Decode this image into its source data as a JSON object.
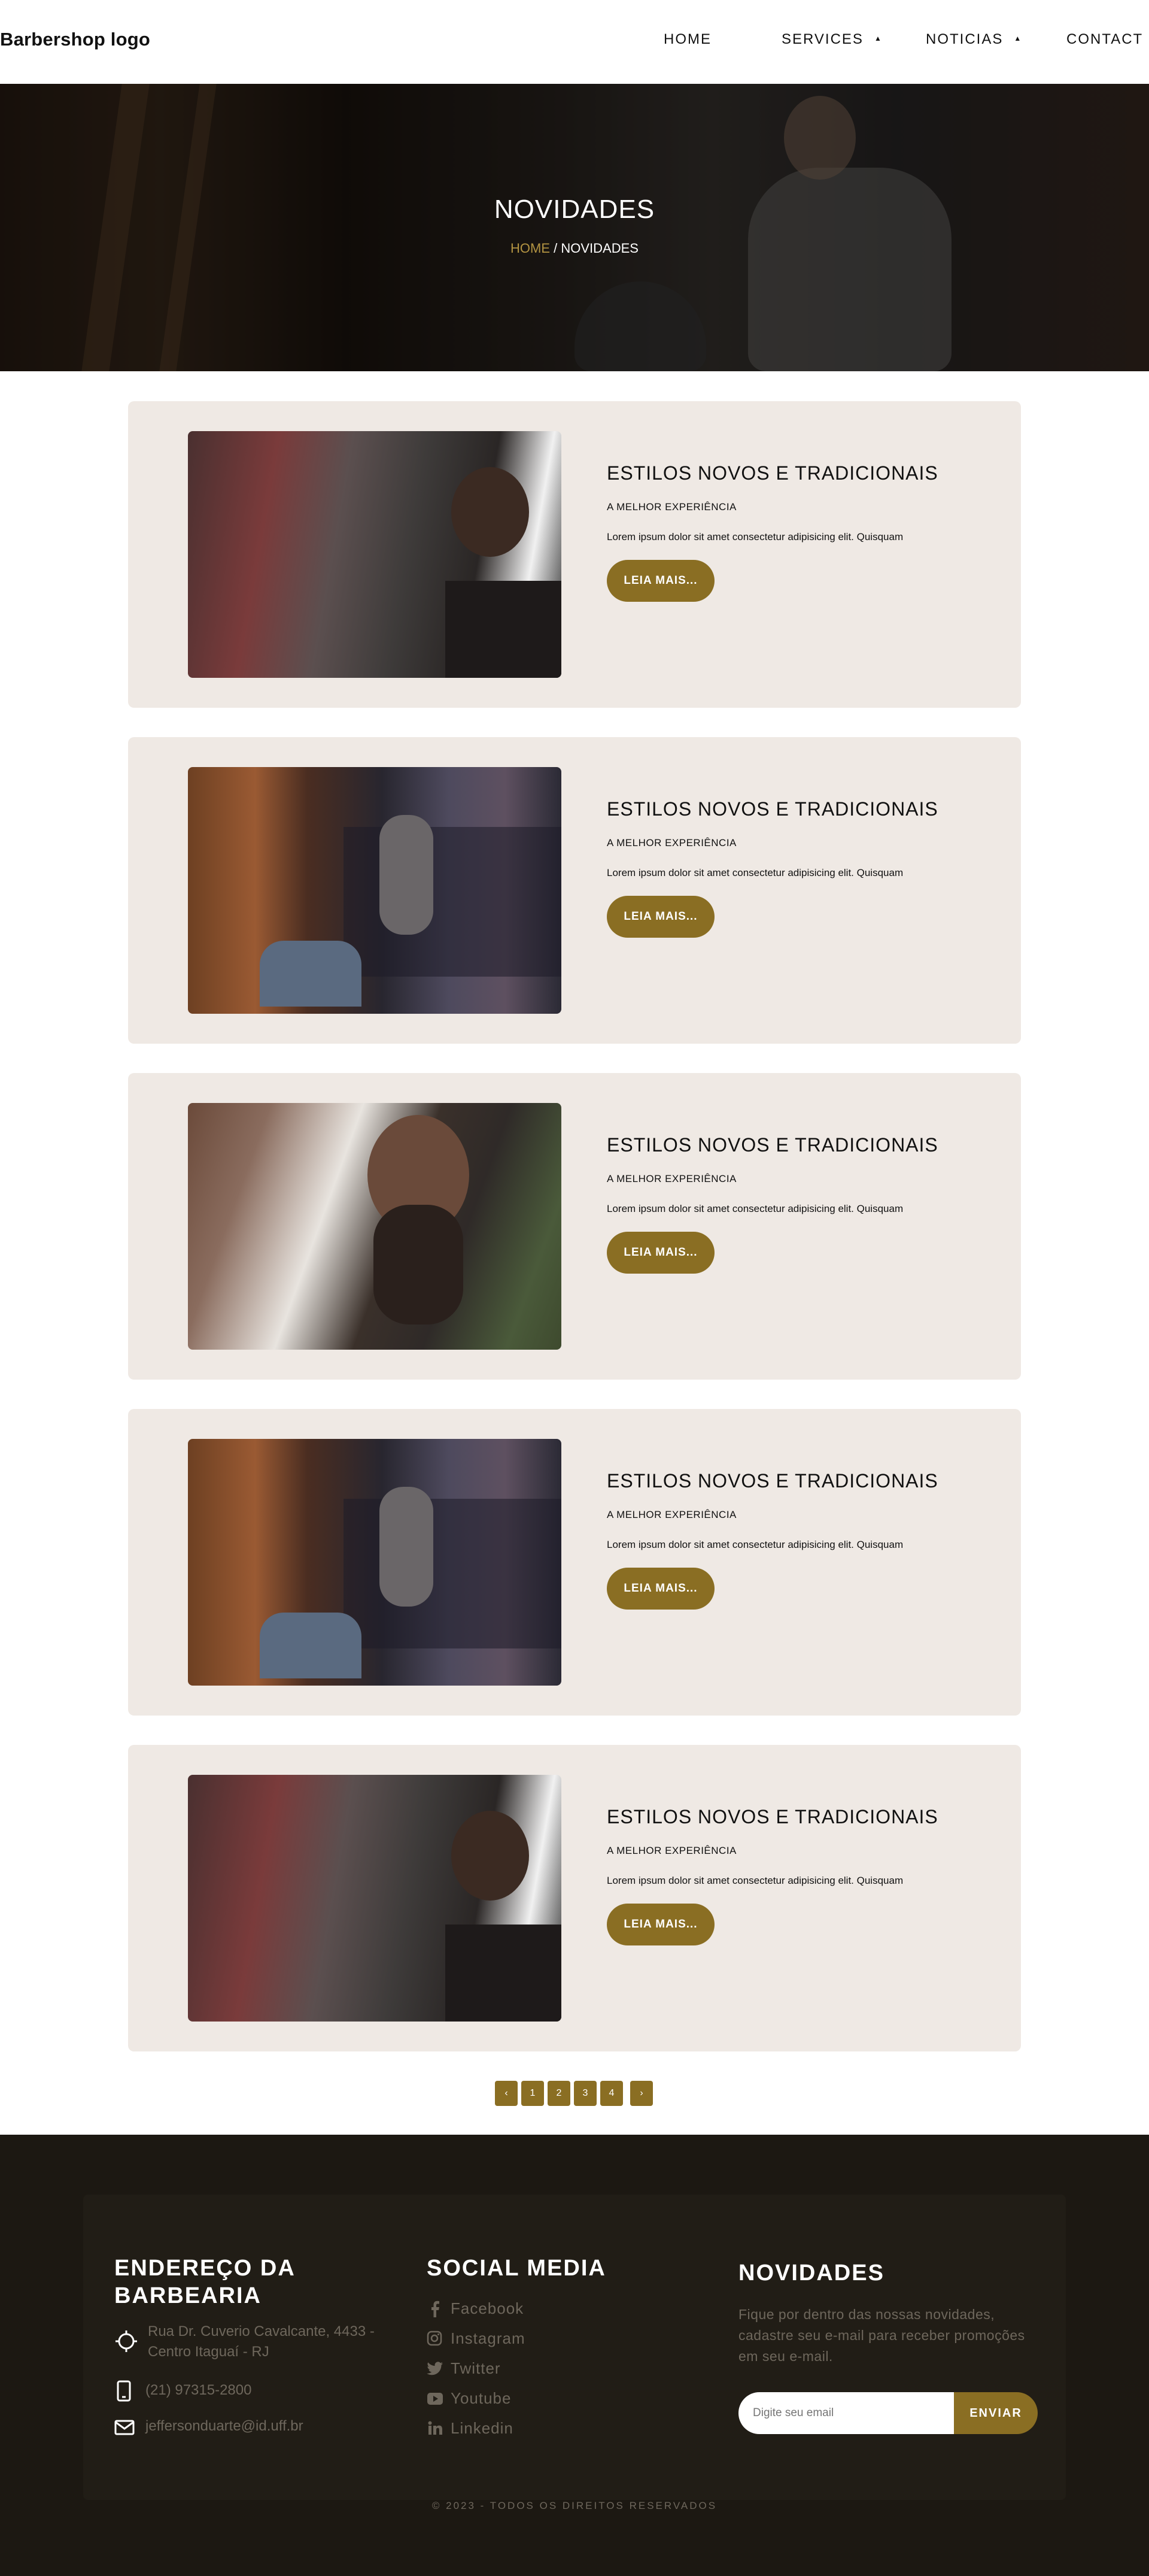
{
  "header": {
    "logo": "Barbershop logo",
    "nav": [
      {
        "label": "HOME"
      },
      {
        "label": "SERVICES"
      },
      {
        "label": "NOTICIAS"
      },
      {
        "label": "CONTACT"
      }
    ],
    "caret": "▲"
  },
  "hero": {
    "title": "NOVIDADES",
    "breadcrumb_home": "HOME",
    "breadcrumb_sep": " / ",
    "breadcrumb_current": "NOVIDADES"
  },
  "posts": [
    {
      "title": "ESTILOS NOVOS E TRADICIONAIS",
      "subtitle": "A MELHOR EXPERIÊNCIA",
      "text": "Lorem ipsum dolor sit amet consectetur adipisicing elit. Quisquam",
      "button": "LEIA MAIS..."
    },
    {
      "title": "ESTILOS NOVOS E TRADICIONAIS",
      "subtitle": "A MELHOR EXPERIÊNCIA",
      "text": "Lorem ipsum dolor sit amet consectetur adipisicing elit. Quisquam",
      "button": "LEIA MAIS..."
    },
    {
      "title": "ESTILOS NOVOS E TRADICIONAIS",
      "subtitle": "A MELHOR EXPERIÊNCIA",
      "text": "Lorem ipsum dolor sit amet consectetur adipisicing elit. Quisquam",
      "button": "LEIA MAIS..."
    },
    {
      "title": "ESTILOS NOVOS E TRADICIONAIS",
      "subtitle": "A MELHOR EXPERIÊNCIA",
      "text": "Lorem ipsum dolor sit amet consectetur adipisicing elit. Quisquam",
      "button": "LEIA MAIS..."
    },
    {
      "title": "ESTILOS NOVOS E TRADICIONAIS",
      "subtitle": "A MELHOR EXPERIÊNCIA",
      "text": "Lorem ipsum dolor sit amet consectetur adipisicing elit. Quisquam",
      "button": "LEIA MAIS..."
    }
  ],
  "pagination": {
    "prev": "‹",
    "pages": [
      "1",
      "2",
      "3",
      "4"
    ],
    "next": "›"
  },
  "footer": {
    "address": {
      "title_line1": "ENDEREÇO DA",
      "title_line2": "BARBEARIA",
      "street_line1": "Rua Dr. Cuverio Cavalcante, 4433 -",
      "street_line2": "Centro Itaguaí - RJ",
      "phone": "(21) 97315-2800",
      "email": "jeffersonduarte@id.uff.br"
    },
    "social": {
      "title": "SOCIAL MEDIA",
      "items": [
        {
          "label": "Facebook",
          "icon": "facebook-icon"
        },
        {
          "label": "Instagram",
          "icon": "instagram-icon"
        },
        {
          "label": "Twitter",
          "icon": "twitter-icon"
        },
        {
          "label": "Youtube",
          "icon": "youtube-icon"
        },
        {
          "label": "Linkedin",
          "icon": "linkedin-icon"
        }
      ]
    },
    "newsletter": {
      "title": "NOVIDADES",
      "text_line1": "Fique por dentro das nossas novidades,",
      "text_line2": "cadastre seu e-mail para receber promoções",
      "text_line3": "em seu e-mail.",
      "placeholder": "Digite seu email",
      "button": "ENVIAR"
    },
    "copyright": "© 2023 - TODOS OS DIREITOS RESERVADOS"
  },
  "colors": {
    "accent": "#8a6e23",
    "breadcrumb_home": "#b39442",
    "card_bg": "#efe9e4",
    "footer_bg": "#1c1812",
    "footer_text": "#6e675c"
  }
}
